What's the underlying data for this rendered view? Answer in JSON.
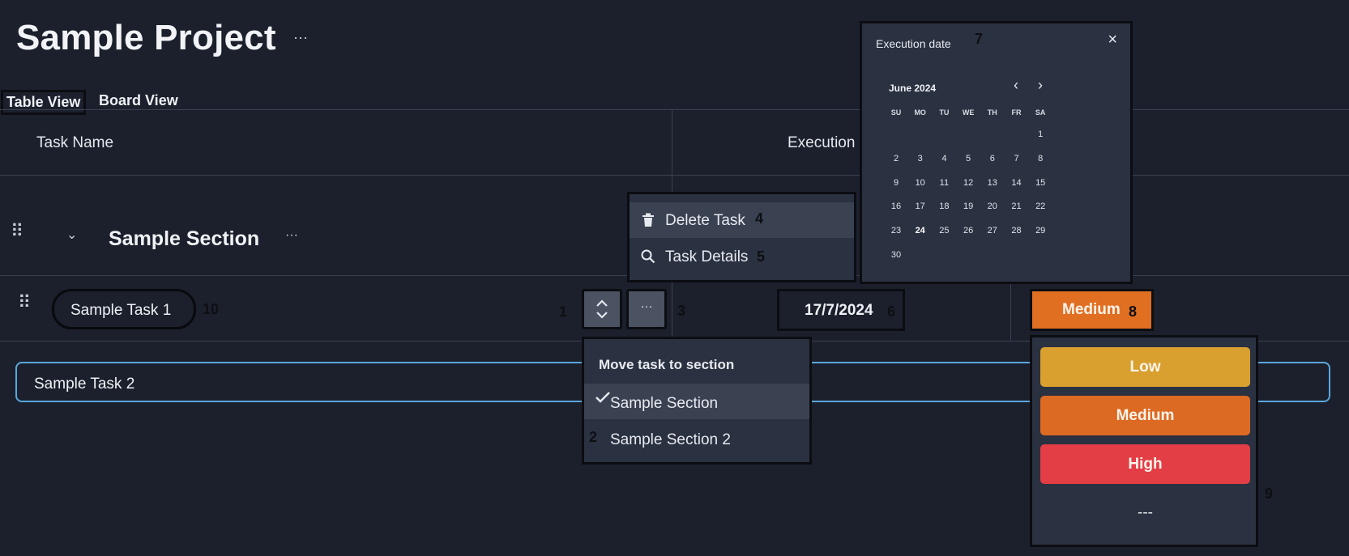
{
  "project": {
    "title": "Sample Project",
    "more_label": "···"
  },
  "tabs": [
    {
      "label": "Table View",
      "active": true
    },
    {
      "label": "Board View",
      "active": false
    }
  ],
  "table": {
    "columns": [
      "Task Name",
      "Execution"
    ],
    "section": {
      "name": "Sample Section",
      "more_label": "···",
      "chevron": "⌄"
    },
    "tasks": [
      {
        "name": "Sample Task 1",
        "execution_date": "17/7/2024",
        "priority": "Medium"
      },
      {
        "name": "Sample Task 2"
      }
    ]
  },
  "annotations": [
    "1",
    "2",
    "3",
    "4",
    "5",
    "6",
    "7",
    "8",
    "9",
    "10"
  ],
  "task_actions": {
    "sort_icon": "chevron-up-down-icon",
    "more_label": "···"
  },
  "context_menu": {
    "items": [
      {
        "label": "Delete Task",
        "icon": "trash-icon"
      },
      {
        "label": "Task Details",
        "icon": "search-icon"
      }
    ]
  },
  "move_menu": {
    "header": "Move task to section",
    "items": [
      {
        "label": "Sample Section",
        "checked": true
      },
      {
        "label": "Sample Section 2",
        "checked": false
      }
    ]
  },
  "calendar": {
    "title": "Execution date",
    "close": "×",
    "month": "June 2024",
    "prev": "‹",
    "next": "›",
    "weekdays": [
      "SU",
      "MO",
      "TU",
      "WE",
      "TH",
      "FR",
      "SA"
    ],
    "first_weekday_index": 6,
    "days_in_month": 30,
    "bold_day": 24
  },
  "priority_menu": {
    "options": [
      {
        "label": "Low",
        "color": "#d9a030"
      },
      {
        "label": "Medium",
        "color": "#dd6a22"
      },
      {
        "label": "High",
        "color": "#e33d46"
      },
      {
        "label": "---",
        "color": ""
      }
    ]
  }
}
